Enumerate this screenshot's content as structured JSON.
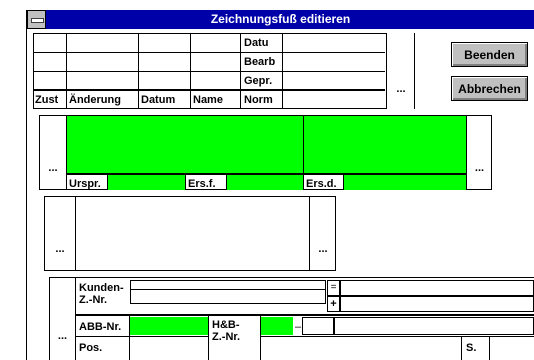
{
  "window": {
    "title": "Zeichnungsfuß editieren"
  },
  "buttons": {
    "beenden": "Beenden",
    "abbrechen": "Abbrechen"
  },
  "revision_table": {
    "right_labels": [
      "Datu",
      "Bearb",
      "Gepr.",
      "Norm"
    ],
    "headers": [
      "Zust",
      "Änderung",
      "Datum",
      "Name"
    ]
  },
  "ellipsis": "...",
  "origin_section": {
    "urspr": "Urspr.",
    "ersf": "Ers.f.",
    "ersd": "Ers.d."
  },
  "customer_section": {
    "kunden_label": "Kunden-\nZ.-Nr.",
    "abb_label": "ABB-Nr.",
    "hb_label": "H&B-\nZ.-Nr.",
    "pos_label": "Pos.",
    "s_label": "S.",
    "eq_symbol": "=",
    "plus_symbol": "+",
    "dash_symbol": "–"
  }
}
